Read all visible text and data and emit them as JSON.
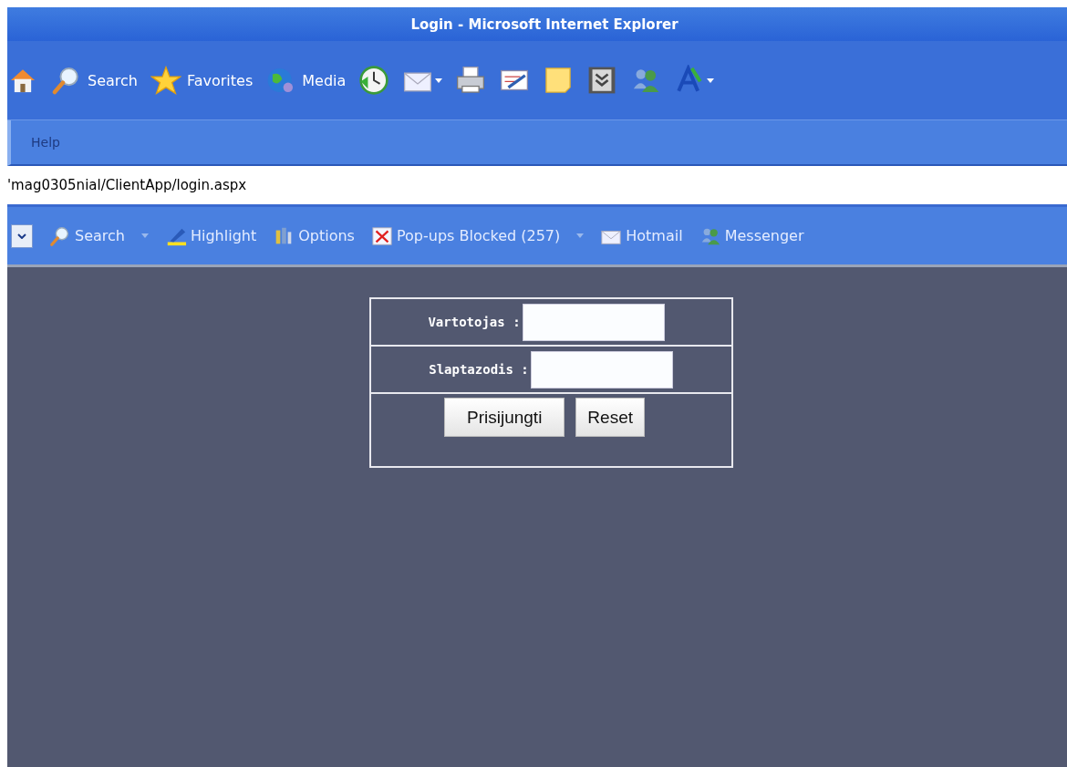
{
  "window": {
    "title": "Login - Microsoft Internet Explorer"
  },
  "toolbar": [
    {
      "kind": "home"
    },
    {
      "kind": "search",
      "label": "Search"
    },
    {
      "kind": "favorites",
      "label": "Favorites"
    },
    {
      "kind": "media",
      "label": "Media"
    },
    {
      "kind": "history"
    },
    {
      "kind": "mail",
      "dropdown": true
    },
    {
      "kind": "print"
    },
    {
      "kind": "edit"
    },
    {
      "kind": "note"
    },
    {
      "kind": "collapse"
    },
    {
      "kind": "people"
    },
    {
      "kind": "font",
      "dropdown": true
    }
  ],
  "menu": [
    {
      "label": "Help"
    }
  ],
  "address": {
    "value": "'mag0305nial/ClientApp/login.aspx"
  },
  "links_bar": [
    {
      "kind": "dropdown"
    },
    {
      "kind": "search",
      "label": "Search",
      "dropdown": true
    },
    {
      "kind": "highlight",
      "label": "Highlight"
    },
    {
      "kind": "options",
      "label": "Options"
    },
    {
      "kind": "popups",
      "label": "Pop-ups Blocked (257)",
      "dropdown": true
    },
    {
      "kind": "mail",
      "label": "Hotmail"
    },
    {
      "kind": "people",
      "label": "Messenger"
    }
  ],
  "login_form": {
    "fields": [
      {
        "label": "Vartotojas :"
      },
      {
        "label": "Slaptazodis :"
      }
    ],
    "buttons": [
      {
        "label": "Prisijungti"
      },
      {
        "label": "Reset"
      }
    ]
  }
}
